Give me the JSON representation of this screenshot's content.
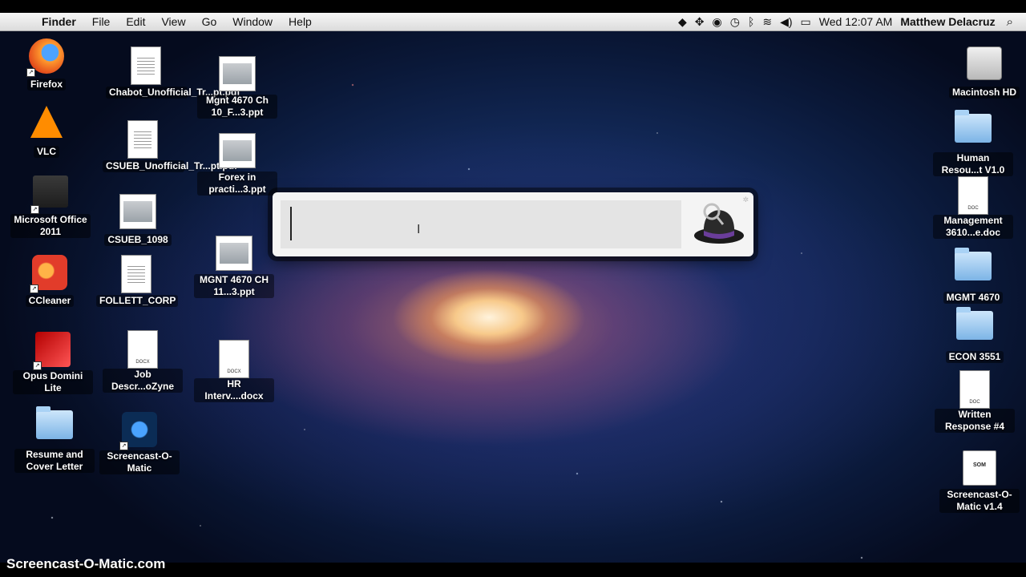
{
  "menubar": {
    "apple_icon": "apple-icon",
    "app_name": "Finder",
    "menus": [
      "File",
      "Edit",
      "View",
      "Go",
      "Window",
      "Help"
    ],
    "clock": "Wed 12:07 AM",
    "user": "Matthew Delacruz"
  },
  "desktop_icons": {
    "firefox": "Firefox",
    "vlc": "VLC",
    "office": "Microsoft Office 2011",
    "ccleaner": "CCleaner",
    "opus": "Opus Domini Lite",
    "resume": "Resume and Cover Letter",
    "chabot": "Chabot_Unofficial_Tr...pt.pdf",
    "csueb_unofficial": "CSUEB_Unofficial_Tr...pt.pdf",
    "csueb_1098": "CSUEB_1098",
    "follett": "FOLLETT_CORP",
    "job_desc": "Job Descr...oZyne",
    "screencast_app": "Screencast-O-Matic",
    "mgnt_ch10": "Mgnt 4670 Ch 10_F...3.ppt",
    "forex": "Forex in practi...3.ppt",
    "mgnt_ch11": "MGNT 4670 CH 11...3.ppt",
    "hr_interv": "HR Interv....docx",
    "macintosh_hd": "Macintosh HD",
    "human_resou": "Human Resou...t V1.0",
    "management_doc": "Management 3610...e.doc",
    "mgmt_4670": "MGMT 4670",
    "econ_3551": "ECON 3551",
    "written_response": "Written Response #4",
    "screencast_v14": "Screencast-O-Matic v1.4"
  },
  "file_tags": {
    "docx": "DOCX",
    "doc": "DOC",
    "som": "SOM"
  },
  "alfred": {
    "query_value": "",
    "hat_icon": "alfred-hat-icon"
  },
  "watermark": "Screencast-O-Matic.com"
}
